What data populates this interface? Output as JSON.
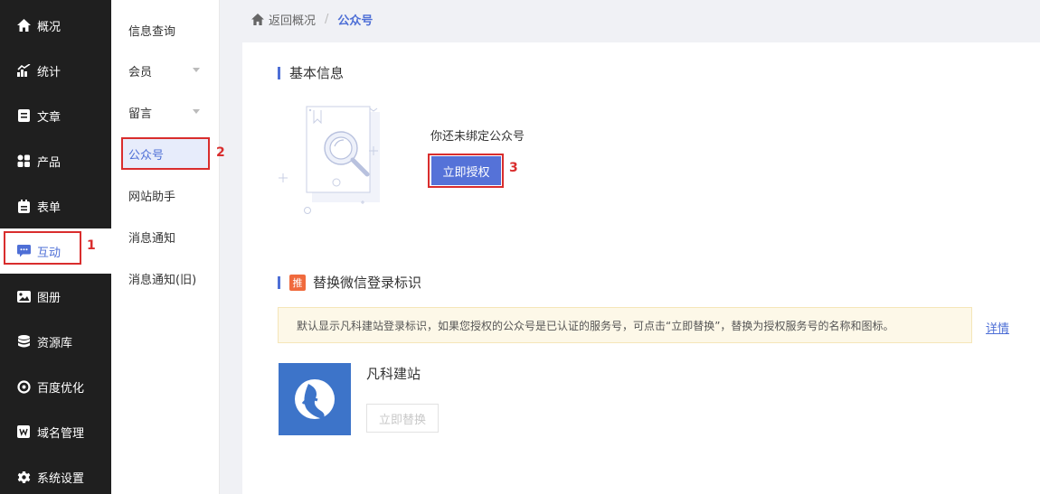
{
  "sidebar": {
    "items": [
      {
        "label": "概况",
        "icon": "home-icon"
      },
      {
        "label": "统计",
        "icon": "stats-icon"
      },
      {
        "label": "文章",
        "icon": "article-icon"
      },
      {
        "label": "产品",
        "icon": "product-icon"
      },
      {
        "label": "表单",
        "icon": "form-icon"
      },
      {
        "label": "互动",
        "icon": "chat-icon",
        "active": true
      },
      {
        "label": "图册",
        "icon": "album-icon"
      },
      {
        "label": "资源库",
        "icon": "database-icon"
      },
      {
        "label": "百度优化",
        "icon": "seo-icon"
      },
      {
        "label": "域名管理",
        "icon": "domain-icon"
      },
      {
        "label": "系统设置",
        "icon": "gear-icon"
      }
    ]
  },
  "subnav": {
    "items": [
      {
        "label": "信息查询"
      },
      {
        "label": "会员",
        "expandable": true
      },
      {
        "label": "留言",
        "expandable": true
      },
      {
        "label": "公众号",
        "active": true
      },
      {
        "label": "网站助手"
      },
      {
        "label": "消息通知"
      },
      {
        "label": "消息通知(旧)"
      }
    ]
  },
  "annotations": {
    "one": "1",
    "two": "2",
    "three": "3"
  },
  "breadcrumb": {
    "back": "返回概况",
    "separator": "/",
    "current": "公众号"
  },
  "basic": {
    "title": "基本信息",
    "unbound_text": "你还未绑定公众号",
    "auth_button": "立即授权"
  },
  "replace": {
    "badge": "推",
    "title": "替换微信登录标识",
    "notice": "默认显示凡科建站登录标识，如果您授权的公众号是已认证的服务号，可点击“立即替换”，替换为授权服务号的名称和图标。",
    "detail_link": "详情",
    "site_name": "凡科建站",
    "replace_button": "立即替换"
  },
  "colors": {
    "accent": "#4e6fd6",
    "sidebar_bg": "#1f1f1f",
    "annotation": "#d92d2d",
    "logo_bg": "#3d74c9"
  }
}
